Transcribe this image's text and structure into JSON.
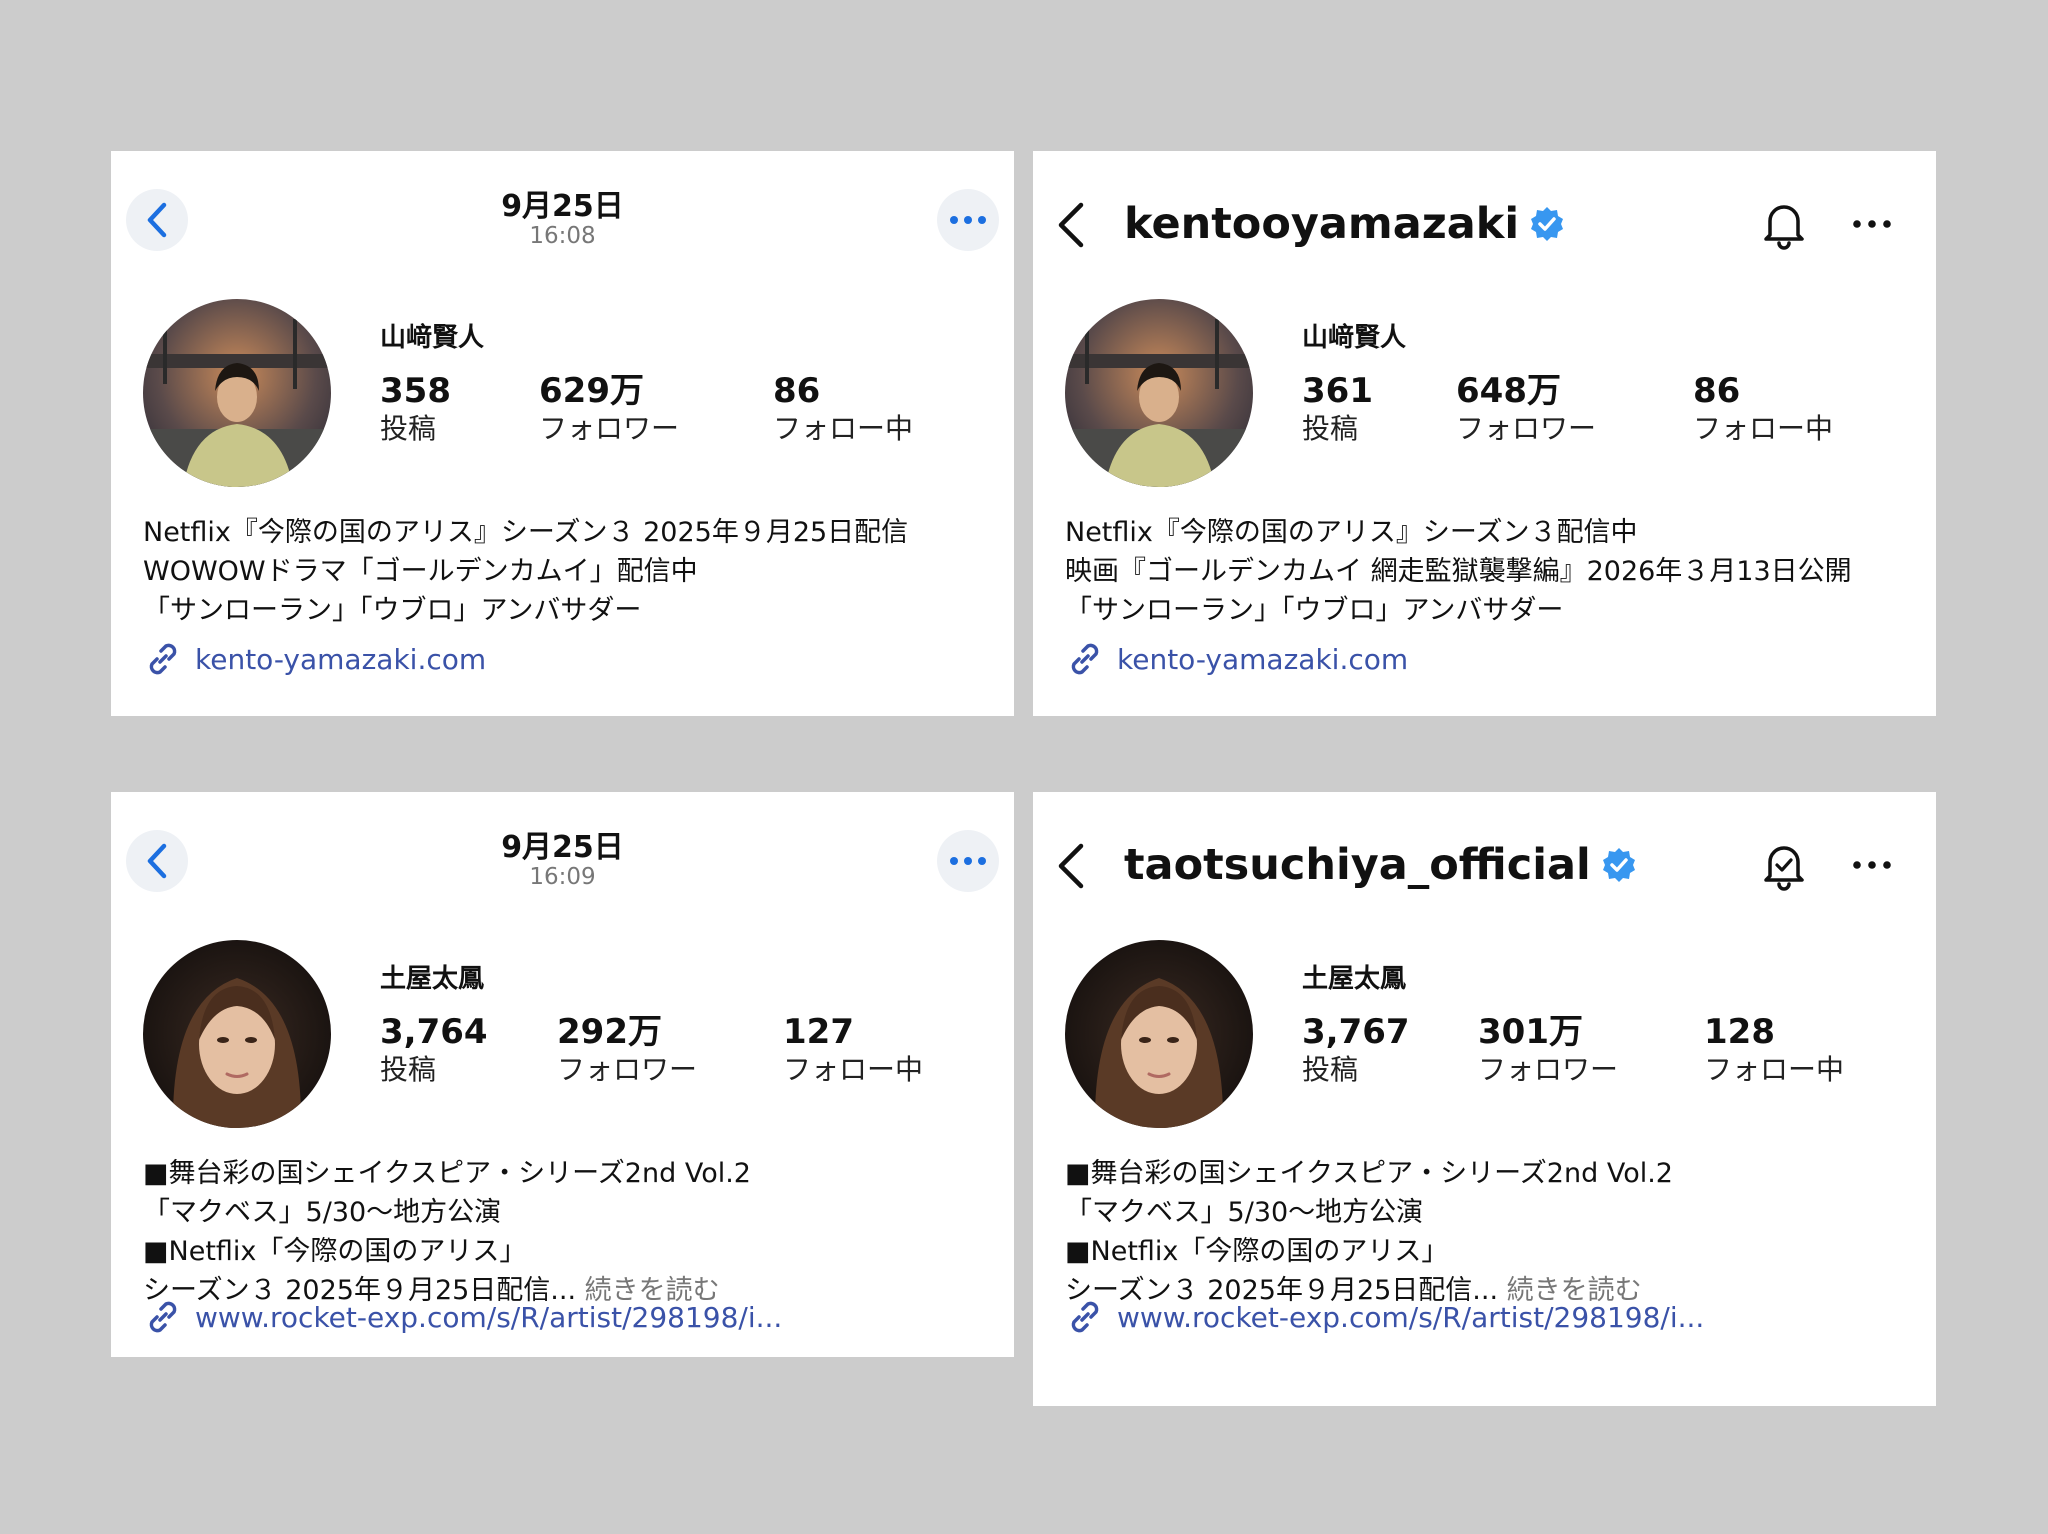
{
  "panels": [
    {
      "header": {
        "date": "9月25日",
        "time": "16:08"
      },
      "name": "山﨑賢人",
      "stats": {
        "posts": "358",
        "posts_label": "投稿",
        "followers": "629万",
        "followers_label": "フォロワー",
        "following": "86",
        "following_label": "フォロー中"
      },
      "bio": [
        "Netflix『今際の国のアリス』シーズン３ 2025年９月25日配信",
        "WOWOWドラマ「ゴールデンカムイ」配信中",
        "「サンローラン」「ウブロ」アンバサダー"
      ],
      "link": "kento-yamazaki.com"
    },
    {
      "header": {
        "username": "kentooyamazaki"
      },
      "name": "山﨑賢人",
      "stats": {
        "posts": "361",
        "posts_label": "投稿",
        "followers": "648万",
        "followers_label": "フォロワー",
        "following": "86",
        "following_label": "フォロー中"
      },
      "bio": [
        "Netflix『今際の国のアリス』シーズン３配信中",
        "映画『ゴールデンカムイ 網走監獄襲撃編』2026年３月13日公開",
        "「サンローラン」「ウブロ」アンバサダー"
      ],
      "link": "kento-yamazaki.com"
    },
    {
      "header": {
        "date": "9月25日",
        "time": "16:09"
      },
      "name": "土屋太鳳",
      "stats": {
        "posts": "3,764",
        "posts_label": "投稿",
        "followers": "292万",
        "followers_label": "フォロワー",
        "following": "127",
        "following_label": "フォロー中"
      },
      "bio": [
        "■舞台彩の国シェイクスピア・シリーズ2nd Vol.2",
        "「マクベス」5/30～地方公演",
        "■Netflix「今際の国のアリス」",
        "シーズン３ 2025年９月25日配信..."
      ],
      "read_more": "続きを読む",
      "link": "www.rocket-exp.com/s/R/artist/298198/i..."
    },
    {
      "header": {
        "username": "taotsuchiya_official"
      },
      "name": "土屋太鳳",
      "stats": {
        "posts": "3,767",
        "posts_label": "投稿",
        "followers": "301万",
        "followers_label": "フォロワー",
        "following": "128",
        "following_label": "フォロー中"
      },
      "bio": [
        "■舞台彩の国シェイクスピア・シリーズ2nd Vol.2",
        "「マクベス」5/30～地方公演",
        "■Netflix「今際の国のアリス」",
        "シーズン３ 2025年９月25日配信..."
      ],
      "read_more": "続きを読む",
      "link": "www.rocket-exp.com/s/R/artist/298198/i..."
    }
  ],
  "colors": {
    "accent": "#1c6fe0",
    "link": "#3a52a8",
    "verified": "#3897f0"
  }
}
